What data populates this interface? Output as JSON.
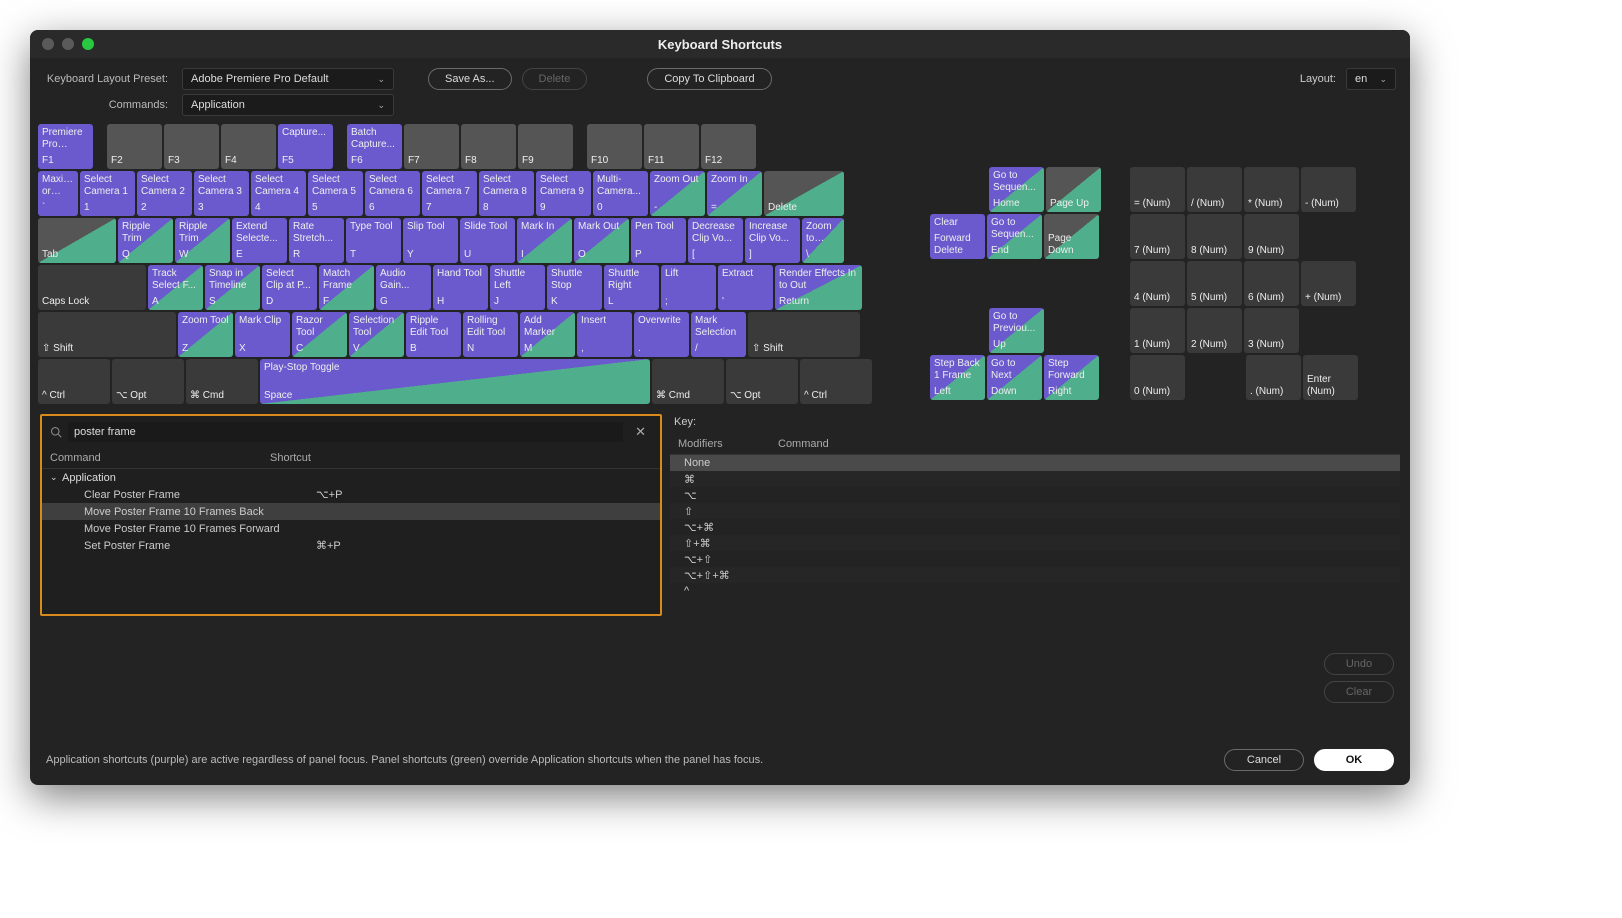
{
  "window": {
    "title": "Keyboard Shortcuts"
  },
  "toolbar": {
    "preset_label": "Keyboard Layout Preset:",
    "preset_value": "Adobe Premiere Pro Default",
    "commands_label": "Commands:",
    "commands_value": "Application",
    "save_as": "Save As...",
    "delete": "Delete",
    "copy": "Copy To Clipboard",
    "layout_label": "Layout:",
    "layout_value": "en"
  },
  "keys": {
    "f1": {
      "cmd": "Premiere Pro Help...",
      "cap": "F1"
    },
    "f2": {
      "cmd": "",
      "cap": "F2"
    },
    "f3": {
      "cmd": "",
      "cap": "F3"
    },
    "f4": {
      "cmd": "",
      "cap": "F4"
    },
    "f5": {
      "cmd": "Capture...",
      "cap": "F5"
    },
    "f6": {
      "cmd": "Batch Capture...",
      "cap": "F6"
    },
    "f7": {
      "cmd": "",
      "cap": "F7"
    },
    "f8": {
      "cmd": "",
      "cap": "F8"
    },
    "f9": {
      "cmd": "",
      "cap": "F9"
    },
    "f10": {
      "cmd": "",
      "cap": "F10"
    },
    "f11": {
      "cmd": "",
      "cap": "F11"
    },
    "f12": {
      "cmd": "",
      "cap": "F12"
    },
    "tilde": {
      "cmd": "Maximize or Rest...",
      "cap": "`"
    },
    "n1": {
      "cmd": "Select Camera 1",
      "cap": "1"
    },
    "n2": {
      "cmd": "Select Camera 2",
      "cap": "2"
    },
    "n3": {
      "cmd": "Select Camera 3",
      "cap": "3"
    },
    "n4": {
      "cmd": "Select Camera 4",
      "cap": "4"
    },
    "n5": {
      "cmd": "Select Camera 5",
      "cap": "5"
    },
    "n6": {
      "cmd": "Select Camera 6",
      "cap": "6"
    },
    "n7": {
      "cmd": "Select Camera 7",
      "cap": "7"
    },
    "n8": {
      "cmd": "Select Camera 8",
      "cap": "8"
    },
    "n9": {
      "cmd": "Select Camera 9",
      "cap": "9"
    },
    "n0": {
      "cmd": "Multi-Camera...",
      "cap": "0"
    },
    "minus": {
      "cmd": "Zoom Out",
      "cap": "-"
    },
    "equals": {
      "cmd": "Zoom In",
      "cap": "="
    },
    "delete": {
      "cmd": "",
      "cap": "Delete"
    },
    "tab": {
      "cmd": "",
      "cap": "Tab"
    },
    "q": {
      "cmd": "Ripple Trim",
      "cap": "Q"
    },
    "w": {
      "cmd": "Ripple Trim",
      "cap": "W"
    },
    "e": {
      "cmd": "Extend Selecte...",
      "cap": "E"
    },
    "r": {
      "cmd": "Rate Stretch...",
      "cap": "R"
    },
    "t": {
      "cmd": "Type Tool",
      "cap": "T"
    },
    "y": {
      "cmd": "Slip Tool",
      "cap": "Y"
    },
    "u": {
      "cmd": "Slide Tool",
      "cap": "U"
    },
    "i": {
      "cmd": "Mark In",
      "cap": "I"
    },
    "o": {
      "cmd": "Mark Out",
      "cap": "O"
    },
    "p": {
      "cmd": "Pen Tool",
      "cap": "P"
    },
    "lbrack": {
      "cmd": "Decrease Clip Vo...",
      "cap": "["
    },
    "rbrack": {
      "cmd": "Increase Clip Vo...",
      "cap": "]"
    },
    "bslash": {
      "cmd": "Zoom to Sequence",
      "cap": "\\"
    },
    "caps": {
      "cmd": "",
      "cap": "Caps Lock"
    },
    "a": {
      "cmd": "Track Select F...",
      "cap": "A"
    },
    "s": {
      "cmd": "Snap in Timeline",
      "cap": "S"
    },
    "d": {
      "cmd": "Select Clip at P...",
      "cap": "D"
    },
    "f": {
      "cmd": "Match Frame",
      "cap": "F"
    },
    "g": {
      "cmd": "Audio Gain...",
      "cap": "G"
    },
    "h": {
      "cmd": "Hand Tool",
      "cap": "H"
    },
    "j": {
      "cmd": "Shuttle Left",
      "cap": "J"
    },
    "k": {
      "cmd": "Shuttle Stop",
      "cap": "K"
    },
    "l": {
      "cmd": "Shuttle Right",
      "cap": "L"
    },
    "semi": {
      "cmd": "Lift",
      "cap": ";"
    },
    "quote": {
      "cmd": "Extract",
      "cap": "'"
    },
    "return": {
      "cmd": "Render Effects In to Out",
      "cap": "Return"
    },
    "lshift": {
      "cap": "⇧ Shift"
    },
    "z": {
      "cmd": "Zoom Tool",
      "cap": "Z"
    },
    "x": {
      "cmd": "Mark Clip",
      "cap": "X"
    },
    "c": {
      "cmd": "Razor Tool",
      "cap": "C"
    },
    "v": {
      "cmd": "Selection Tool",
      "cap": "V"
    },
    "b": {
      "cmd": "Ripple Edit Tool",
      "cap": "B"
    },
    "n": {
      "cmd": "Rolling Edit Tool",
      "cap": "N"
    },
    "m": {
      "cmd": "Add Marker",
      "cap": "M"
    },
    "comma": {
      "cmd": "Insert",
      "cap": ","
    },
    "period": {
      "cmd": "Overwrite",
      "cap": "."
    },
    "slash": {
      "cmd": "Mark Selection",
      "cap": "/"
    },
    "rshift": {
      "cap": "⇧ Shift"
    },
    "lctrl": {
      "cap": "^ Ctrl"
    },
    "lopt": {
      "cap": "⌥ Opt"
    },
    "lcmd": {
      "cap": "⌘ Cmd"
    },
    "space": {
      "cmd": "Play-Stop Toggle",
      "cap": "Space"
    },
    "rcmd": {
      "cap": "⌘ Cmd"
    },
    "ropt": {
      "cap": "⌥ Opt"
    },
    "rctrl": {
      "cap": "^ Ctrl"
    },
    "fwddel": {
      "cmd": "Clear",
      "cap": "Forward Delete"
    },
    "home": {
      "cmd": "Go to Sequen...",
      "cap": "Home"
    },
    "pgup": {
      "cmd": "",
      "cap": "Page Up"
    },
    "end": {
      "cmd": "Go to Sequen...",
      "cap": "End"
    },
    "pgdn": {
      "cmd": "",
      "cap": "Page Down"
    },
    "up": {
      "cmd": "Go to Previou...",
      "cap": "Up"
    },
    "left": {
      "cmd": "Step Back 1 Frame",
      "cap": "Left"
    },
    "down": {
      "cmd": "Go to Next",
      "cap": "Down"
    },
    "right": {
      "cmd": "Step Forward",
      "cap": "Right"
    },
    "numEq": {
      "cap": "= (Num)"
    },
    "numDiv": {
      "cap": "/ (Num)"
    },
    "numMul": {
      "cap": "* (Num)"
    },
    "numSub": {
      "cap": "- (Num)"
    },
    "num7": {
      "cap": "7 (Num)"
    },
    "num8": {
      "cap": "8 (Num)"
    },
    "num9": {
      "cap": "9 (Num)"
    },
    "num4": {
      "cap": "4 (Num)"
    },
    "num5": {
      "cap": "5 (Num)"
    },
    "num6": {
      "cap": "6 (Num)"
    },
    "numAdd": {
      "cap": "+ (Num)"
    },
    "num1": {
      "cap": "1 (Num)"
    },
    "num2": {
      "cap": "2 (Num)"
    },
    "num3": {
      "cap": "3 (Num)"
    },
    "num0": {
      "cap": "0 (Num)"
    },
    "numDot": {
      "cap": ". (Num)"
    },
    "numEnter": {
      "cap": "Enter (Num)"
    }
  },
  "search": {
    "value": "poster frame"
  },
  "commandTable": {
    "col1": "Command",
    "col2": "Shortcut",
    "group": "Application",
    "rows": [
      {
        "name": "Clear Poster Frame",
        "shortcut": "⌥+P"
      },
      {
        "name": "Move Poster Frame 10 Frames Back",
        "shortcut": ""
      },
      {
        "name": "Move Poster Frame 10 Frames Forward",
        "shortcut": ""
      },
      {
        "name": "Set Poster Frame",
        "shortcut": "⌘+P"
      }
    ],
    "selectedIndex": 1
  },
  "keyPanel": {
    "label": "Key:",
    "col1": "Modifiers",
    "col2": "Command",
    "rows": [
      "None",
      "⌘",
      "⌥",
      "⇧",
      "⌥+⌘",
      "⇧+⌘",
      "⌥+⇧",
      "⌥+⇧+⌘",
      "^"
    ]
  },
  "sideButtons": {
    "undo": "Undo",
    "clear": "Clear"
  },
  "footer": {
    "hint": "Application shortcuts (purple) are active regardless of panel focus. Panel shortcuts (green) override Application shortcuts when the panel has focus.",
    "cancel": "Cancel",
    "ok": "OK"
  }
}
